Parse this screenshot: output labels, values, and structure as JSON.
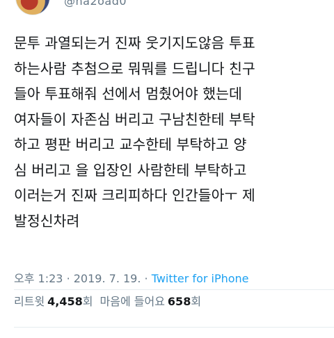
{
  "author": {
    "handle": "@na2oad0"
  },
  "tweet": {
    "lines": [
      "문투 과열되는거 진짜 웃기지도않음 투표",
      "하는사람 추첨으로 뭐뭐를 드립니다 친구",
      "들아 투표해줘 선에서 멈췄어야 했는데",
      "여자들이 자존심 버리고 구남친한테 부탁",
      "하고 평판 버리고 교수한테 부탁하고 양",
      "심 버리고 을 입장인 사람한테 부탁하고",
      "이러는거 진짜 크리피하다 인간들아ㅜ 제",
      "발정신차려"
    ]
  },
  "meta": {
    "time": "오후 1:23",
    "separator": "·",
    "date": "2019. 7. 19.",
    "source": "Twitter for iPhone"
  },
  "stats": {
    "retweets_label": "리트윗",
    "retweets_count": "4,458",
    "retweets_unit": "회",
    "likes_label": "마음에 들어요",
    "likes_count": "658",
    "likes_unit": "회"
  }
}
